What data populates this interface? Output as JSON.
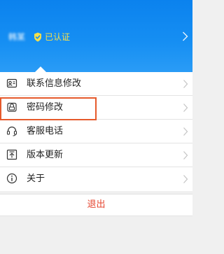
{
  "header": {
    "username": "韩某",
    "verified_label": "已认证",
    "verified_color": "#f6e04a",
    "background": "#168ff3"
  },
  "menu": {
    "items": [
      {
        "label": "联系信息修改",
        "icon": "contact-card-icon"
      },
      {
        "label": "密码修改",
        "icon": "lock-icon"
      },
      {
        "label": "客服电话",
        "icon": "headset-icon"
      },
      {
        "label": "版本更新",
        "icon": "upload-icon"
      },
      {
        "label": "关于",
        "icon": "info-icon"
      }
    ],
    "highlighted_index": 1,
    "highlight_color": "#e65a2c"
  },
  "logout": {
    "label": "退出",
    "color": "#e5452f"
  }
}
